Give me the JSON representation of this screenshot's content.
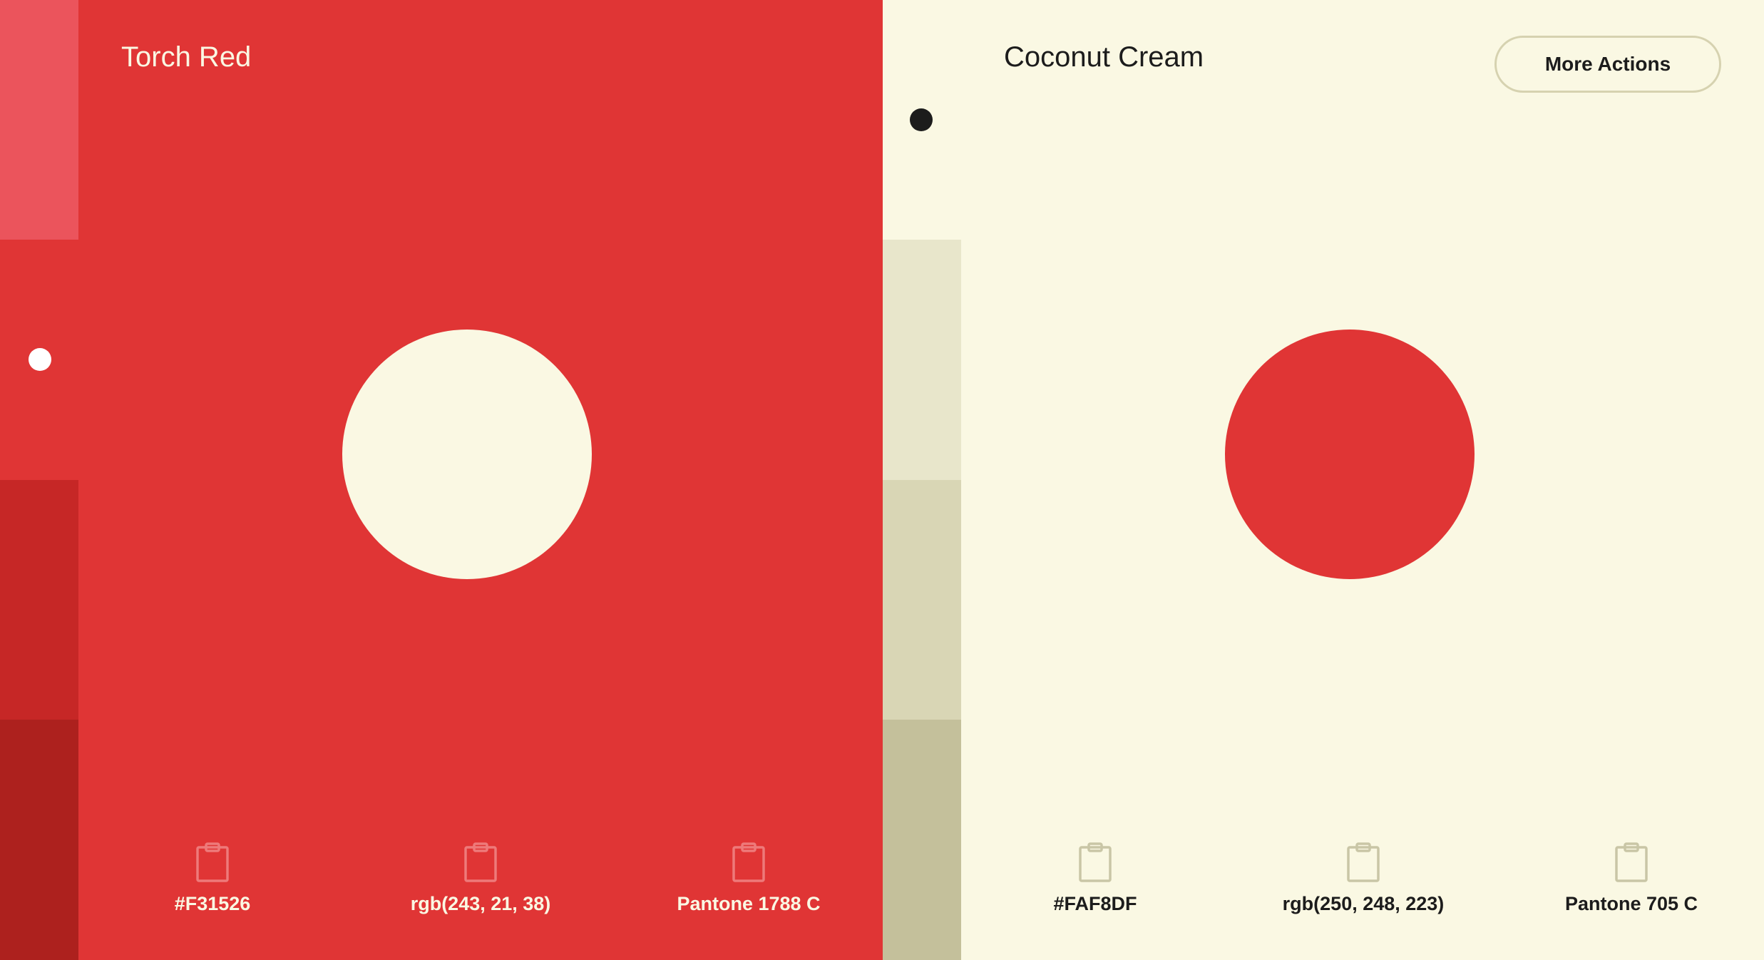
{
  "colors": {
    "red": "#E03535",
    "red_light": "#EB545C",
    "red_dark": "#C62726",
    "red_darker": "#AD211E",
    "cream": "#FAF8E3",
    "cream_light": "#E8E6CB",
    "cream_mid": "#D9D6B5",
    "cream_dark": "#C4C09B",
    "text_light": "#FAF8E3",
    "text_dark": "#1C1C1C",
    "clip_on_red": "#EE7A7A",
    "clip_on_cream": "#C9C6A6",
    "button_border": "#D6D2B0",
    "dot_dark": "#1C1C1C",
    "dot_light": "#FFFFFF"
  },
  "left": {
    "name": "Torch Red",
    "hex": "#F31526",
    "rgb": "rgb(243, 21, 38)",
    "pantone": "Pantone 1788 C",
    "clip_icon": "clipboard-icon"
  },
  "right": {
    "name": "Coconut Cream",
    "hex": "#FAF8DF",
    "rgb": "rgb(250, 248, 223)",
    "pantone": "Pantone 705 C",
    "clip_icon": "clipboard-icon"
  },
  "actions": {
    "more_label": "More Actions"
  }
}
